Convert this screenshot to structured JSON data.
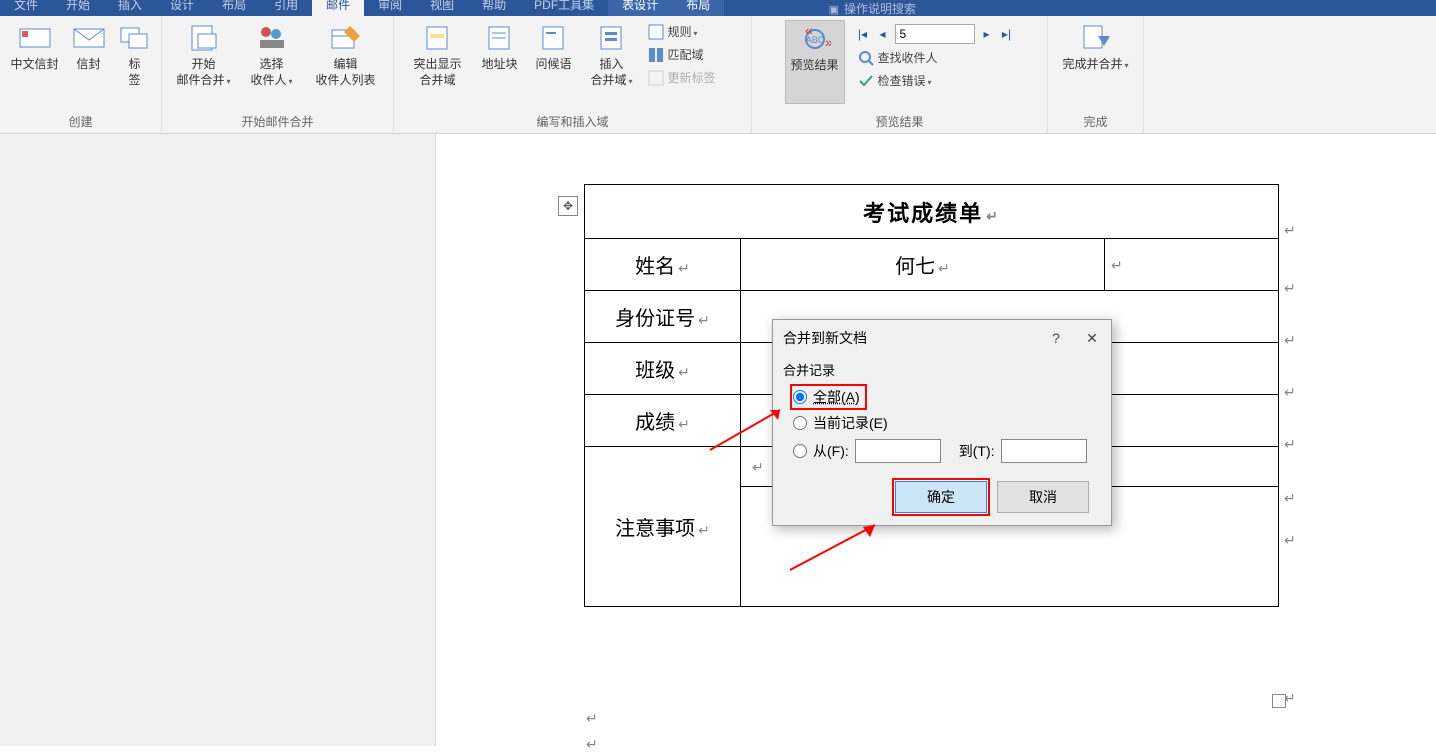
{
  "tabs": {
    "t0": "文件",
    "t1": "开始",
    "t2": "插入",
    "t3": "设计",
    "t4": "布局",
    "t5": "引用",
    "t6": "邮件",
    "t7": "审阅",
    "t8": "视图",
    "t9": "帮助",
    "t10": "PDF工具集",
    "t11": "表设计",
    "t12": "布局",
    "search": "操作说明搜索"
  },
  "ribbon": {
    "g1": {
      "label": "创建",
      "btn_cn_env": "中文信封",
      "btn_env": "信封",
      "btn_label": "标\n签"
    },
    "g2": {
      "label": "开始邮件合并",
      "btn_start": "开始\n邮件合并",
      "btn_select": "选择\n收件人",
      "btn_edit": "编辑\n收件人列表"
    },
    "g3": {
      "label": "编写和插入域",
      "btn_highlight": "突出显示\n合并域",
      "btn_addr": "地址块",
      "btn_greet": "问候语",
      "btn_insert": "插入\n合并域",
      "it_rules": "规则",
      "it_match": "匹配域",
      "it_update": "更新标签"
    },
    "g4": {
      "label": "预览结果",
      "btn_preview": "预览结果",
      "record_value": "5",
      "it_find": "查找收件人",
      "it_check": "检查错误"
    },
    "g5": {
      "label": "完成",
      "btn_finish": "完成并合并"
    }
  },
  "doc": {
    "title": "考试成绩单",
    "row_name_lbl": "姓名",
    "row_name_val": "何七",
    "row_id_lbl": "身份证号",
    "row_class_lbl": "班级",
    "row_score_lbl": "成绩",
    "row_note_lbl": "注意事项"
  },
  "dialog": {
    "title": "合并到新文档",
    "section": "合并记录",
    "opt_all": "全部(A)",
    "opt_current": "当前记录(E)",
    "opt_from": "从(F):",
    "opt_to": "到(T):",
    "btn_ok": "确定",
    "btn_cancel": "取消",
    "help": "?",
    "close": "✕"
  }
}
